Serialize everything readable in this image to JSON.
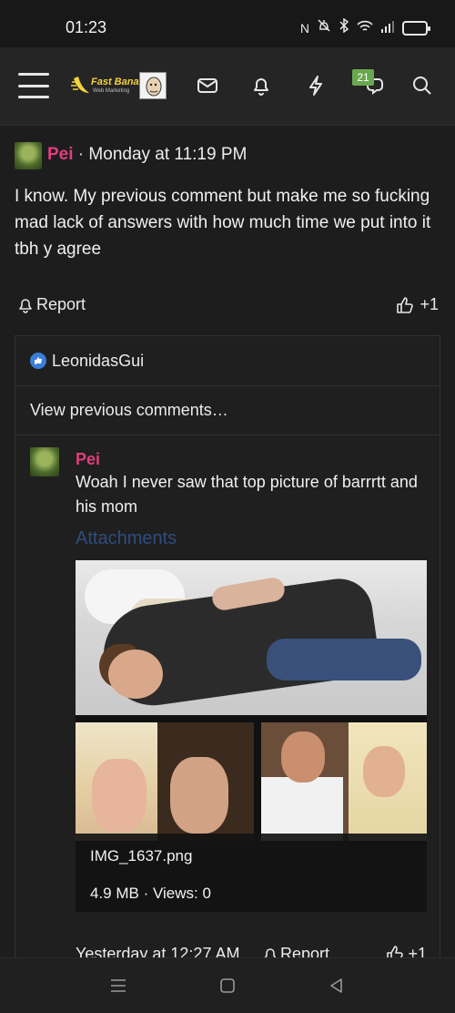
{
  "status_bar": {
    "time": "01:23",
    "icons": [
      "nfc-icon",
      "mute-icon",
      "bluetooth-icon",
      "wifi-icon",
      "signal-icon",
      "battery-icon"
    ]
  },
  "nav": {
    "logo_text": "Fast Banana",
    "logo_sub": "Web Marketing",
    "notification_badge": "21",
    "icons": [
      "menu-icon",
      "avatar",
      "mail-icon",
      "bell-icon",
      "bolt-icon",
      "chat-icon",
      "search-icon"
    ]
  },
  "post": {
    "username": "Pei",
    "separator": " · ",
    "timestamp": "Monday at 11:19 PM",
    "body": "I know. My previous comment but make me so fucking mad lack of answers with how much time we put into it tbh y agree",
    "report_label": "Report",
    "like_count": "+1"
  },
  "comments": {
    "reaction_user": "LeonidasGui",
    "view_previous": "View previous comments…",
    "comment": {
      "username": "Pei",
      "text": "Woah I never saw that top picture of barrrtt and his mom",
      "attachments_title": "Attachments",
      "attachment_name": "IMG_1637.png",
      "attachment_meta": "4.9 MB · Views: 0",
      "date": "Yesterday at 12:27 AM",
      "report_label": "Report",
      "like_count": "+1"
    }
  },
  "colors": {
    "username": "#e03e7c",
    "badge": "#6aa84f",
    "attachments": "#2f4d7e",
    "background": "#1d1d1d"
  }
}
